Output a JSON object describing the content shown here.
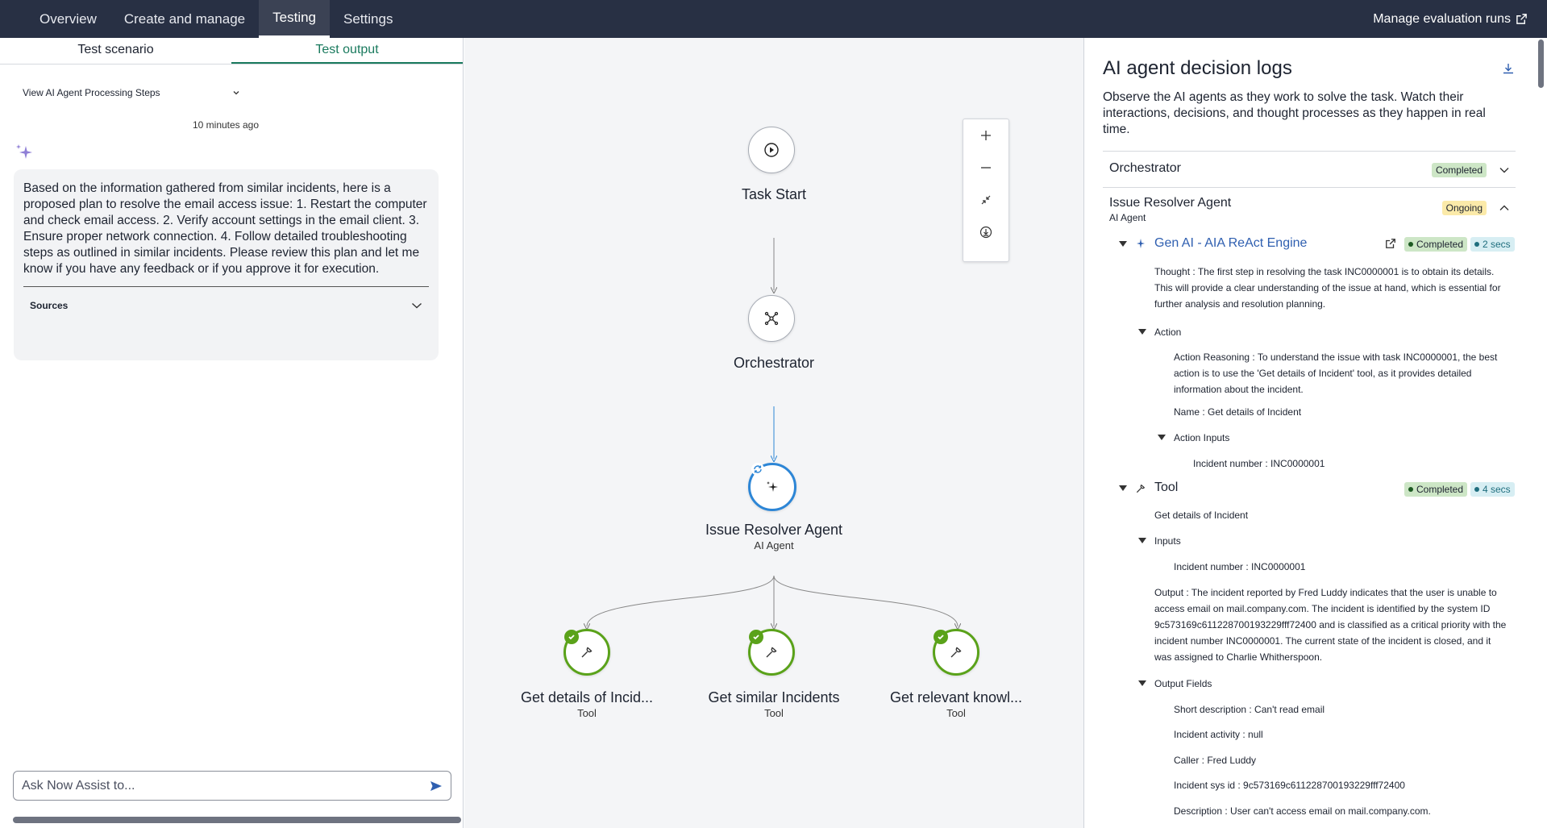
{
  "topnav": {
    "tabs": [
      "Overview",
      "Create and manage",
      "Testing",
      "Settings"
    ],
    "active": "Testing",
    "manage_label": "Manage evaluation runs"
  },
  "left": {
    "subtabs": [
      "Test scenario",
      "Test output"
    ],
    "steps_select": "View AI Agent Processing Steps",
    "timestamp": "10 minutes ago",
    "message": "Based on the information gathered from similar incidents, here is a proposed plan to resolve the email access issue: 1. Restart the computer and check email access. 2. Verify account settings in the email client. 3. Ensure proper network connection. 4. Follow detailed troubleshooting steps as outlined in similar incidents. Please review this plan and let me know if you have any feedback or if you approve it for execution.",
    "sources_label": "Sources",
    "ask_placeholder": "Ask Now Assist to..."
  },
  "canvas": {
    "task_start": "Task Start",
    "orchestrator": "Orchestrator",
    "agent_name": "Issue Resolver Agent",
    "agent_type": "AI Agent",
    "tools": [
      {
        "name": "Get details of Incid...",
        "type": "Tool"
      },
      {
        "name": "Get similar Incidents",
        "type": "Tool"
      },
      {
        "name": "Get relevant knowl...",
        "type": "Tool"
      }
    ],
    "zoom_controls": [
      "zoom-in",
      "zoom-out",
      "fit",
      "download"
    ]
  },
  "right": {
    "title": "AI agent decision logs",
    "description": "Observe the AI agents as they work to solve the task. Watch their interactions, decisions, and thought processes as they happen in real time.",
    "orchestrator": {
      "name": "Orchestrator",
      "status": "Completed"
    },
    "agent": {
      "name": "Issue Resolver Agent",
      "type": "AI Agent",
      "status": "Ongoing"
    },
    "genai": {
      "title": "Gen AI - AIA ReAct Engine",
      "status": "Completed",
      "duration": "2 secs",
      "thought": "Thought : The first step in resolving the task INC0000001 is to obtain its details. This will provide a clear understanding of the issue at hand, which is essential for further analysis and resolution planning.",
      "action_label": "Action",
      "action_reasoning": "Action Reasoning : To understand the issue with task INC0000001, the best action is to use the 'Get details of Incident' tool, as it provides detailed information about the incident.",
      "action_name": "Name : Get details of Incident",
      "action_inputs_label": "Action Inputs",
      "action_input": "Incident number : INC0000001"
    },
    "tool": {
      "title": "Tool",
      "status": "Completed",
      "duration": "4 secs",
      "name": "Get details of Incident",
      "inputs_label": "Inputs",
      "input": "Incident number : INC0000001",
      "output": "Output : The incident reported by Fred Luddy indicates that the user is unable to access email on mail.company.com. The incident is identified by the system ID 9c573169c611228700193229fff72400 and is classified as a critical priority with the incident number INC0000001. The current state of the incident is closed, and it was assigned to Charlie Whitherspoon.",
      "output_fields_label": "Output Fields",
      "fields": [
        "Short description : Can't read email",
        "Incident activity : null",
        "Caller : Fred Luddy",
        "Incident sys id : 9c573169c611228700193229fff72400",
        "Description : User can't access email on mail.company.com."
      ]
    }
  },
  "colors": {
    "nav_bg": "#283044",
    "accent_green": "#1a7a5e",
    "tool_ring": "#5aa21a",
    "agent_ring": "#2d86d6",
    "link_blue": "#2f5fb0"
  }
}
